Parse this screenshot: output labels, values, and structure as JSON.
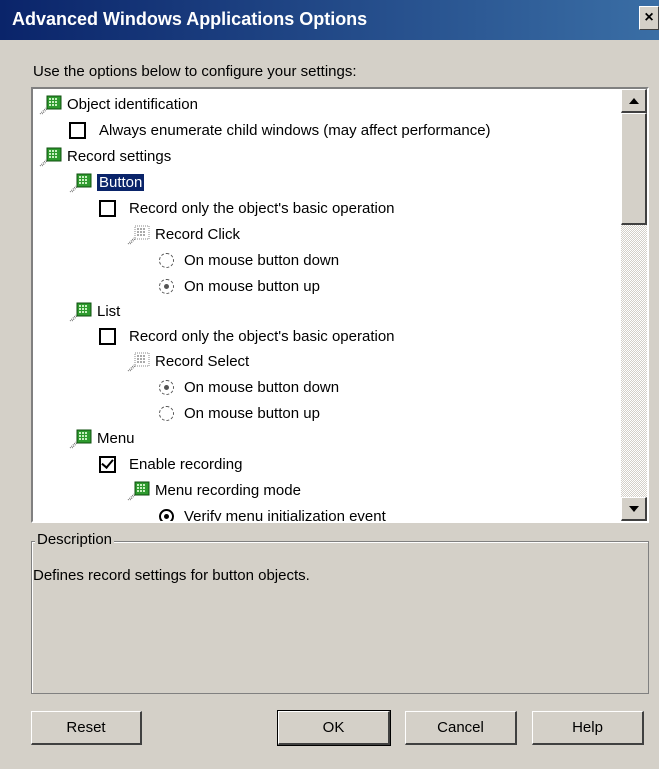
{
  "window": {
    "title": "Advanced Windows Applications Options",
    "close_label": "×"
  },
  "instructions": "Use the options below to configure your settings:",
  "tree": {
    "object_identification": "Object identification",
    "always_enumerate": "Always enumerate child windows (may affect performance)",
    "record_settings": "Record settings",
    "button": "Button",
    "button_basic_op": "Record only the object's basic operation",
    "record_click": "Record Click",
    "button_mouse_down": "On mouse button down",
    "button_mouse_up": "On mouse button up",
    "list": "List",
    "list_basic_op": "Record only the object's basic operation",
    "record_select": "Record Select",
    "list_mouse_down": "On mouse button down",
    "list_mouse_up": "On mouse button up",
    "menu": "Menu",
    "enable_recording": "Enable recording",
    "menu_recording_mode": "Menu recording mode",
    "verify_menu_init": "Verify menu initialization event"
  },
  "state": {
    "always_enumerate_checked": false,
    "button_basic_op_checked": false,
    "button_click_selected": "On mouse button up",
    "list_basic_op_checked": false,
    "list_select_selected": "On mouse button down",
    "enable_recording_checked": true,
    "menu_mode_selected": "Verify menu initialization event"
  },
  "description": {
    "legend": "Description",
    "text": "Defines record settings for button objects."
  },
  "buttons": {
    "reset": "Reset",
    "ok": "OK",
    "cancel": "Cancel",
    "help": "Help"
  },
  "colors": {
    "title_bar": "#0a246a",
    "dialog_bg": "#d4d0c8",
    "selection": "#0a246a",
    "tree_icon": "#2e9a2e"
  }
}
